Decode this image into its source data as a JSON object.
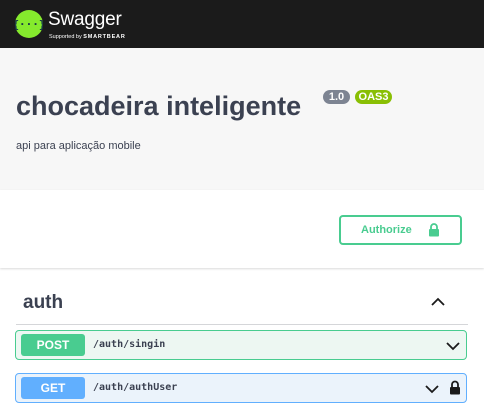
{
  "topbar": {
    "logo_icon": "swagger-braces-icon",
    "brand": "Swagger",
    "supported_prefix": "Supported by",
    "supported_brand": "SMARTBEAR",
    "colors": {
      "background": "#1b1b1b",
      "logo": "#85ea2d"
    }
  },
  "info": {
    "title": "chocadeira inteligente",
    "version": "1.0",
    "spec": "OAS3",
    "description": "api para aplicação mobile"
  },
  "authorize": {
    "label": "Authorize",
    "icon": "lock-icon",
    "color": "#49cc90"
  },
  "tag": {
    "name": "auth",
    "toggle_icon": "chevron-up-icon"
  },
  "operations": [
    {
      "method": "POST",
      "path": "/auth/singin",
      "color": "#49cc90",
      "icon": "chevron-down-icon"
    },
    {
      "method": "GET",
      "path": "/auth/authUser",
      "color": "#61affe",
      "icon": "chevron-down-icon",
      "lock_icon": "lock-icon"
    }
  ]
}
